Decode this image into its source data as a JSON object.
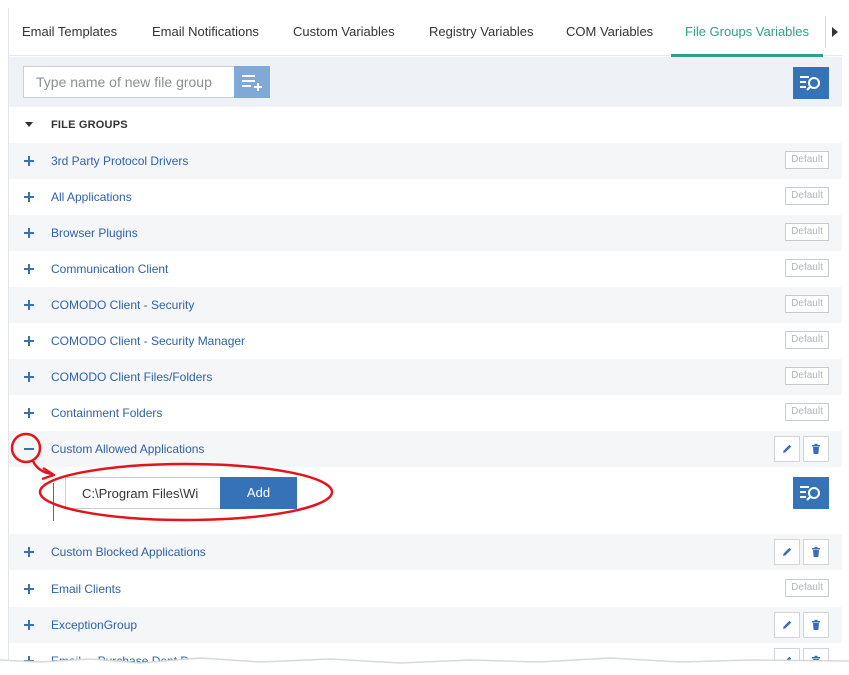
{
  "tabs": [
    {
      "label": "Email Templates",
      "active": false
    },
    {
      "label": "Email Notifications",
      "active": false
    },
    {
      "label": "Custom Variables",
      "active": false
    },
    {
      "label": "Registry Variables",
      "active": false
    },
    {
      "label": "COM Variables",
      "active": false
    },
    {
      "label": "File Groups Variables",
      "active": true
    }
  ],
  "toolbar": {
    "new_group_placeholder": "Type name of new file group",
    "add_icon": "add-list-icon",
    "search_icon": "search-list-icon"
  },
  "section": {
    "title": "FILE GROUPS"
  },
  "rows": [
    {
      "name": "3rd Party Protocol Drivers",
      "badge": "Default"
    },
    {
      "name": "All Applications",
      "badge": "Default"
    },
    {
      "name": "Browser Plugins",
      "badge": "Default"
    },
    {
      "name": "Communication Client",
      "badge": "Default"
    },
    {
      "name": "COMODO Client - Security",
      "badge": "Default"
    },
    {
      "name": "COMODO Client - Security Manager",
      "badge": "Default"
    },
    {
      "name": "COMODO Client Files/Folders",
      "badge": "Default"
    },
    {
      "name": "Containment Folders",
      "badge": "Default"
    },
    {
      "name": "Custom Allowed Applications",
      "expanded": true,
      "editable": true
    },
    {
      "name": "Custom Blocked Applications",
      "editable": true
    },
    {
      "name": "Email Clients",
      "badge": "Default"
    },
    {
      "name": "ExceptionGroup",
      "editable": true
    },
    {
      "name": "Email ... Purchase Dept D...",
      "editable": true
    }
  ],
  "expanded_panel": {
    "path_value": "C:\\Program Files\\Wi",
    "add_label": "Add"
  },
  "colors": {
    "accent": "#2aa389",
    "primary": "#3572b8",
    "link": "#2f62a8",
    "annotation": "#e3141b"
  }
}
